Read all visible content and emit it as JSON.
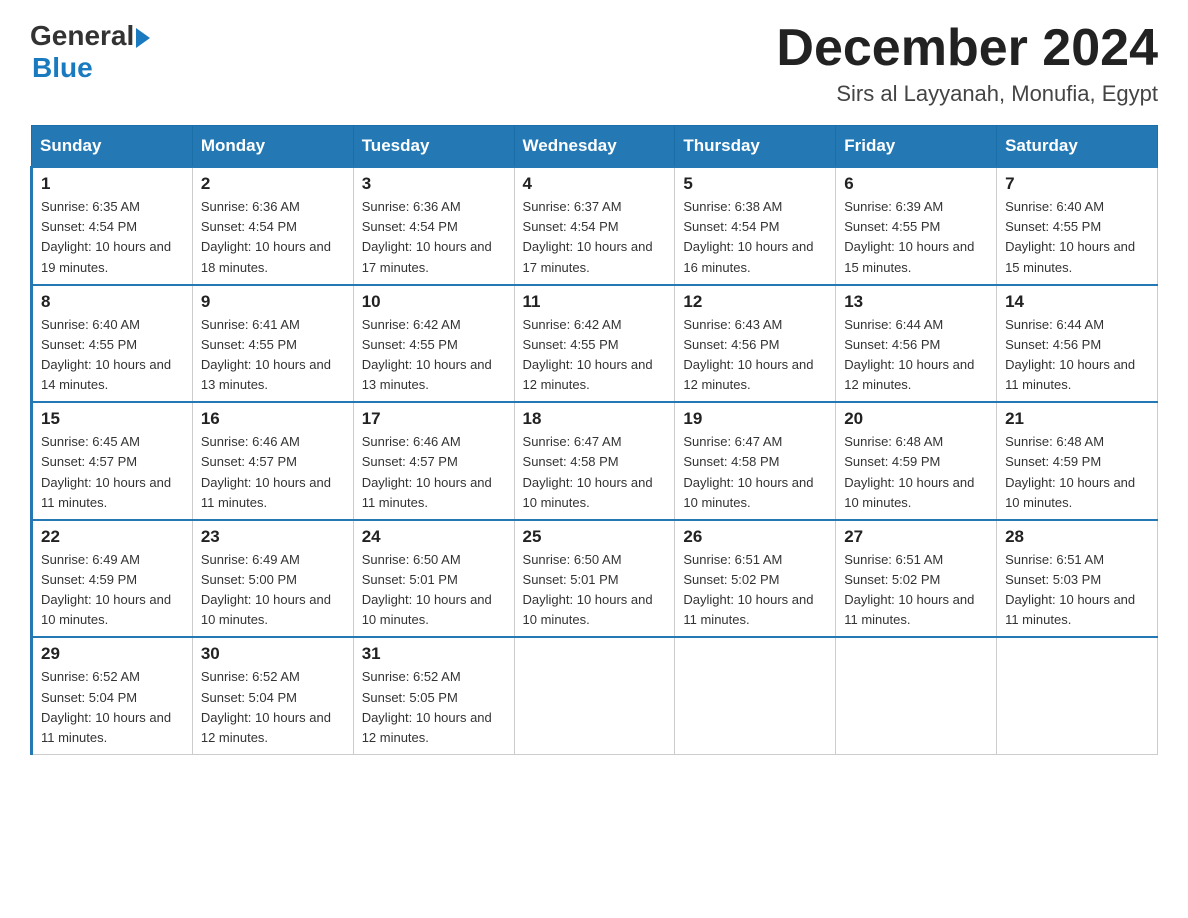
{
  "header": {
    "logo_general": "General",
    "logo_blue": "Blue",
    "month_title": "December 2024",
    "location": "Sirs al Layyanah, Monufia, Egypt"
  },
  "days_of_week": [
    "Sunday",
    "Monday",
    "Tuesday",
    "Wednesday",
    "Thursday",
    "Friday",
    "Saturday"
  ],
  "weeks": [
    [
      {
        "day": 1,
        "sunrise": "6:35 AM",
        "sunset": "4:54 PM",
        "daylight": "10 hours and 19 minutes."
      },
      {
        "day": 2,
        "sunrise": "6:36 AM",
        "sunset": "4:54 PM",
        "daylight": "10 hours and 18 minutes."
      },
      {
        "day": 3,
        "sunrise": "6:36 AM",
        "sunset": "4:54 PM",
        "daylight": "10 hours and 17 minutes."
      },
      {
        "day": 4,
        "sunrise": "6:37 AM",
        "sunset": "4:54 PM",
        "daylight": "10 hours and 17 minutes."
      },
      {
        "day": 5,
        "sunrise": "6:38 AM",
        "sunset": "4:54 PM",
        "daylight": "10 hours and 16 minutes."
      },
      {
        "day": 6,
        "sunrise": "6:39 AM",
        "sunset": "4:55 PM",
        "daylight": "10 hours and 15 minutes."
      },
      {
        "day": 7,
        "sunrise": "6:40 AM",
        "sunset": "4:55 PM",
        "daylight": "10 hours and 15 minutes."
      }
    ],
    [
      {
        "day": 8,
        "sunrise": "6:40 AM",
        "sunset": "4:55 PM",
        "daylight": "10 hours and 14 minutes."
      },
      {
        "day": 9,
        "sunrise": "6:41 AM",
        "sunset": "4:55 PM",
        "daylight": "10 hours and 13 minutes."
      },
      {
        "day": 10,
        "sunrise": "6:42 AM",
        "sunset": "4:55 PM",
        "daylight": "10 hours and 13 minutes."
      },
      {
        "day": 11,
        "sunrise": "6:42 AM",
        "sunset": "4:55 PM",
        "daylight": "10 hours and 12 minutes."
      },
      {
        "day": 12,
        "sunrise": "6:43 AM",
        "sunset": "4:56 PM",
        "daylight": "10 hours and 12 minutes."
      },
      {
        "day": 13,
        "sunrise": "6:44 AM",
        "sunset": "4:56 PM",
        "daylight": "10 hours and 12 minutes."
      },
      {
        "day": 14,
        "sunrise": "6:44 AM",
        "sunset": "4:56 PM",
        "daylight": "10 hours and 11 minutes."
      }
    ],
    [
      {
        "day": 15,
        "sunrise": "6:45 AM",
        "sunset": "4:57 PM",
        "daylight": "10 hours and 11 minutes."
      },
      {
        "day": 16,
        "sunrise": "6:46 AM",
        "sunset": "4:57 PM",
        "daylight": "10 hours and 11 minutes."
      },
      {
        "day": 17,
        "sunrise": "6:46 AM",
        "sunset": "4:57 PM",
        "daylight": "10 hours and 11 minutes."
      },
      {
        "day": 18,
        "sunrise": "6:47 AM",
        "sunset": "4:58 PM",
        "daylight": "10 hours and 10 minutes."
      },
      {
        "day": 19,
        "sunrise": "6:47 AM",
        "sunset": "4:58 PM",
        "daylight": "10 hours and 10 minutes."
      },
      {
        "day": 20,
        "sunrise": "6:48 AM",
        "sunset": "4:59 PM",
        "daylight": "10 hours and 10 minutes."
      },
      {
        "day": 21,
        "sunrise": "6:48 AM",
        "sunset": "4:59 PM",
        "daylight": "10 hours and 10 minutes."
      }
    ],
    [
      {
        "day": 22,
        "sunrise": "6:49 AM",
        "sunset": "4:59 PM",
        "daylight": "10 hours and 10 minutes."
      },
      {
        "day": 23,
        "sunrise": "6:49 AM",
        "sunset": "5:00 PM",
        "daylight": "10 hours and 10 minutes."
      },
      {
        "day": 24,
        "sunrise": "6:50 AM",
        "sunset": "5:01 PM",
        "daylight": "10 hours and 10 minutes."
      },
      {
        "day": 25,
        "sunrise": "6:50 AM",
        "sunset": "5:01 PM",
        "daylight": "10 hours and 10 minutes."
      },
      {
        "day": 26,
        "sunrise": "6:51 AM",
        "sunset": "5:02 PM",
        "daylight": "10 hours and 11 minutes."
      },
      {
        "day": 27,
        "sunrise": "6:51 AM",
        "sunset": "5:02 PM",
        "daylight": "10 hours and 11 minutes."
      },
      {
        "day": 28,
        "sunrise": "6:51 AM",
        "sunset": "5:03 PM",
        "daylight": "10 hours and 11 minutes."
      }
    ],
    [
      {
        "day": 29,
        "sunrise": "6:52 AM",
        "sunset": "5:04 PM",
        "daylight": "10 hours and 11 minutes."
      },
      {
        "day": 30,
        "sunrise": "6:52 AM",
        "sunset": "5:04 PM",
        "daylight": "10 hours and 12 minutes."
      },
      {
        "day": 31,
        "sunrise": "6:52 AM",
        "sunset": "5:05 PM",
        "daylight": "10 hours and 12 minutes."
      },
      null,
      null,
      null,
      null
    ]
  ]
}
